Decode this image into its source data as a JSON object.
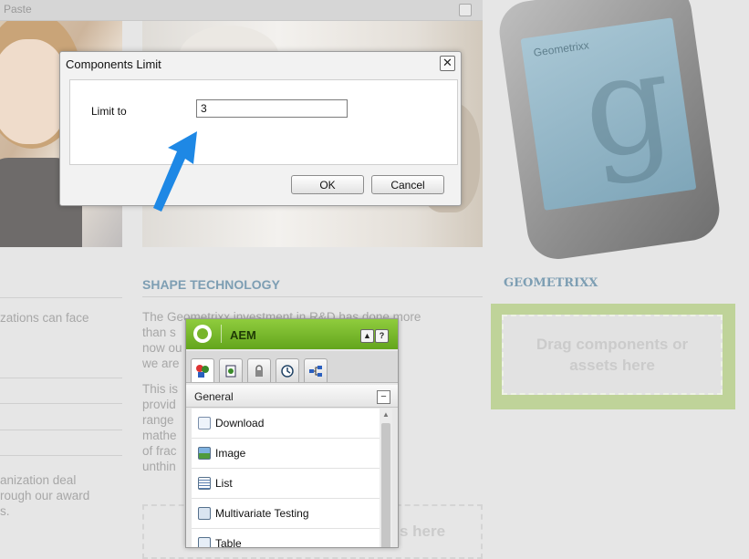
{
  "toolbar": {
    "paste_label": "Paste"
  },
  "phone": {
    "brand": "Geometrixx",
    "glyph": "g"
  },
  "sections": {
    "shape_heading": "SHAPE TECHNOLOGY",
    "geo_heading": "GEOMETRIXX",
    "shape_para1": "The Geometrixx investment in R&D has done more\nthan s                                       , we have\nnow ou                                      n extent that\nwe are",
    "shape_para2": "This is                                      d polyhedra\nprovid                                       s the whole\nrange\nmathe                                        generation\nof frac                                      are\nunthin",
    "left_para1": "zations can face",
    "left_para2": "anization deal\nrough our award\ns.",
    "dropzone_text": "Drag components or assets here",
    "dropzone_bottom_text": "s here"
  },
  "dialog": {
    "title": "Components Limit",
    "close_glyph": "✕",
    "limit_label": "Limit to",
    "limit_value": "3",
    "ok_label": "OK",
    "cancel_label": "Cancel"
  },
  "sidekick": {
    "title": "AEM",
    "up_glyph": "▲",
    "help_glyph": "?",
    "group_label": "General",
    "group_toggle": "−",
    "tabs": [
      "components-icon",
      "page-icon",
      "lock-icon",
      "versioning-icon",
      "workflow-icon"
    ],
    "items": [
      {
        "label": "Download",
        "icon": "download-icon"
      },
      {
        "label": "Image",
        "icon": "image-icon"
      },
      {
        "label": "List",
        "icon": "list-icon"
      },
      {
        "label": "Multivariate Testing",
        "icon": "multivariate-icon"
      },
      {
        "label": "Table",
        "icon": "table-icon"
      }
    ]
  },
  "colors": {
    "sidekick_green": "#78b52b",
    "dropzone_green": "#bfd399",
    "heading_blue": "#7d9eb3",
    "arrow_blue": "#1e88e5"
  }
}
